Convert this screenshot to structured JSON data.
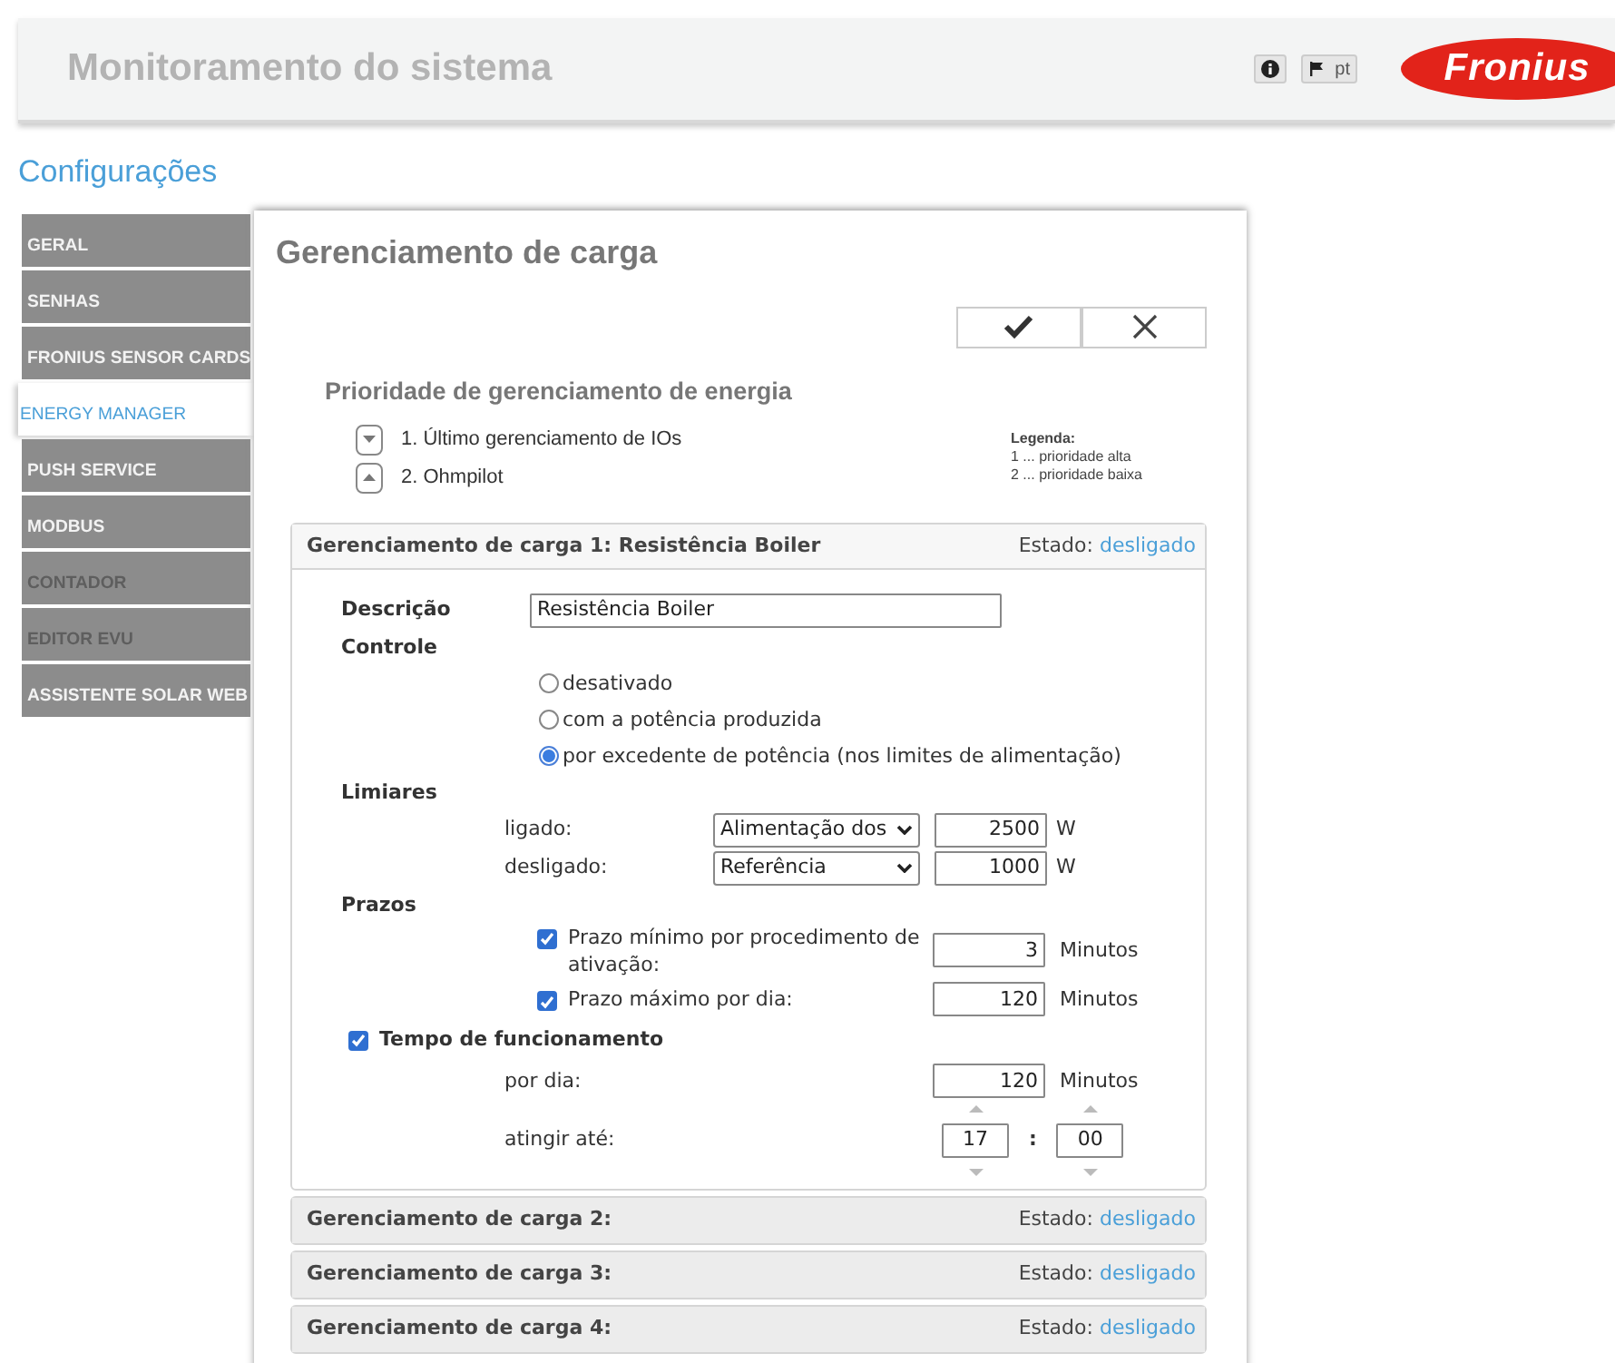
{
  "header": {
    "title": "Monitoramento do sistema",
    "language": "pt",
    "logo": "Fronius"
  },
  "page_title": "Configurações",
  "sidebar": {
    "items": [
      {
        "label": "GERAL",
        "selected": false,
        "disabled": false
      },
      {
        "label": "SENHAS",
        "selected": false,
        "disabled": false
      },
      {
        "label": "FRONIUS SENSOR CARDS",
        "selected": false,
        "disabled": false
      },
      {
        "label": "ENERGY MANAGER",
        "selected": true,
        "disabled": false
      },
      {
        "label": "PUSH SERVICE",
        "selected": false,
        "disabled": false
      },
      {
        "label": "MODBUS",
        "selected": false,
        "disabled": false
      },
      {
        "label": "CONTADOR",
        "selected": false,
        "disabled": true
      },
      {
        "label": "EDITOR EVU",
        "selected": false,
        "disabled": true
      },
      {
        "label": "ASSISTENTE SOLAR WEB",
        "selected": false,
        "disabled": false
      }
    ]
  },
  "panel": {
    "title": "Gerenciamento de carga",
    "buttons": [
      {
        "kind": "save"
      },
      {
        "kind": "cancel"
      }
    ]
  },
  "priority": {
    "title": "Prioridade de gerenciamento de energia",
    "items": [
      {
        "label": "1. Último gerenciamento de IOs",
        "kind": "down"
      },
      {
        "label": "2. Ohmpilot",
        "kind": "up"
      }
    ],
    "legend": {
      "title": "Legenda:",
      "lines": [
        "1 ... prioridade alta",
        "2 ... prioridade baixa"
      ]
    }
  },
  "loads": [
    {
      "title": "Gerenciamento de carga 1: Resistência Boiler",
      "status_label": "Estado:",
      "status": "desligado",
      "expanded": true,
      "form": {
        "description": {
          "label": "Descrição",
          "value": "Resistência Boiler"
        },
        "control": {
          "label": "Controle",
          "options": [
            {
              "label": "desativado",
              "selected": false
            },
            {
              "label": "com a potência produzida",
              "selected": false
            },
            {
              "label": "por excedente de potência (nos limites de alimentação)",
              "selected": true
            }
          ]
        },
        "thresholds": {
          "label": "Limiares",
          "rows": [
            {
              "label": "ligado:",
              "select": "Alimentação dos",
              "value": "2500",
              "unit": "W"
            },
            {
              "label": "desligado:",
              "select": "Referência",
              "value": "1000",
              "unit": "W"
            }
          ]
        },
        "deadlines": {
          "label": "Prazos",
          "rows": [
            {
              "label": "Prazo mínimo por procedimento de ativação:",
              "checked": true,
              "value": "3",
              "unit": "Minutos"
            },
            {
              "label": "Prazo máximo por dia:",
              "checked": true,
              "value": "120",
              "unit": "Minutos"
            }
          ]
        },
        "runtime": {
          "label": "Tempo de funcionamento",
          "checked": true,
          "per_day": {
            "label": "por dia:",
            "value": "120",
            "unit": "Minutos"
          },
          "reach": {
            "label": "atingir até:",
            "hour": "17",
            "separator": ":",
            "minute": "00"
          }
        }
      }
    },
    {
      "title": "Gerenciamento de carga 2:",
      "status_label": "Estado:",
      "status": "desligado",
      "expanded": false
    },
    {
      "title": "Gerenciamento de carga 3:",
      "status_label": "Estado:",
      "status": "desligado",
      "expanded": false
    },
    {
      "title": "Gerenciamento de carga 4:",
      "status_label": "Estado:",
      "status": "desligado",
      "expanded": false
    }
  ]
}
